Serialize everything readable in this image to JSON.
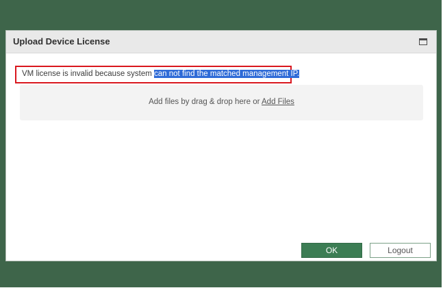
{
  "dialog": {
    "title": "Upload Device License",
    "window_icon": "window-maximize-icon"
  },
  "error": {
    "prefix": "VM license is invalid because system ",
    "highlighted": "can not find the matched management IP.",
    "border_color": "#d9161d",
    "highlight_color": "#2f6bd7"
  },
  "dropzone": {
    "text_before_link": "Add files by drag & drop here or ",
    "link_label": "Add Files"
  },
  "buttons": {
    "ok_label": "OK",
    "logout_label": "Logout"
  },
  "colors": {
    "backdrop": "#3e654a",
    "primary_button": "#3c7d54"
  }
}
